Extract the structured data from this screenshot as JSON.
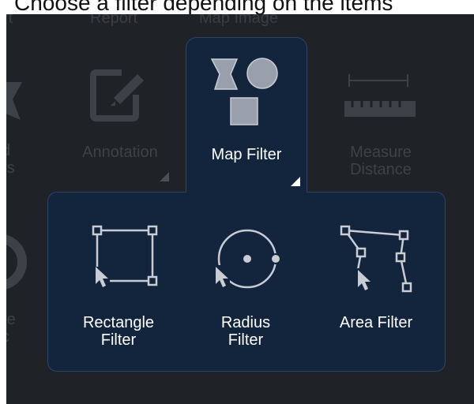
{
  "caption": "Choose a filter depending on the items",
  "background_toolbar": {
    "top_labels": [
      "rt",
      "Report",
      "Map Image"
    ],
    "annotation_label": "Annotation",
    "measure_label": [
      "Measure",
      "Distance"
    ],
    "left_cut_label_1": [
      "d",
      "rs"
    ],
    "left_cut_label_2": [
      "re",
      "c"
    ]
  },
  "map_filter": {
    "label": "Map Filter",
    "icon": "shapes-icon"
  },
  "filter_menu": [
    {
      "label_line1": "Rectangle",
      "label_line2": "Filter",
      "icon": "rectangle-select-icon"
    },
    {
      "label_line1": "Radius",
      "label_line2": "Filter",
      "icon": "radius-select-icon"
    },
    {
      "label_line1": "Area Filter",
      "label_line2": "",
      "icon": "area-select-icon"
    }
  ],
  "colors": {
    "panel_bg": "#1f2226",
    "active_bg": "#13243d",
    "active_border": "#2a4468",
    "icon_light": "#c9ccd2",
    "icon_fill": "#9aa0ab"
  }
}
